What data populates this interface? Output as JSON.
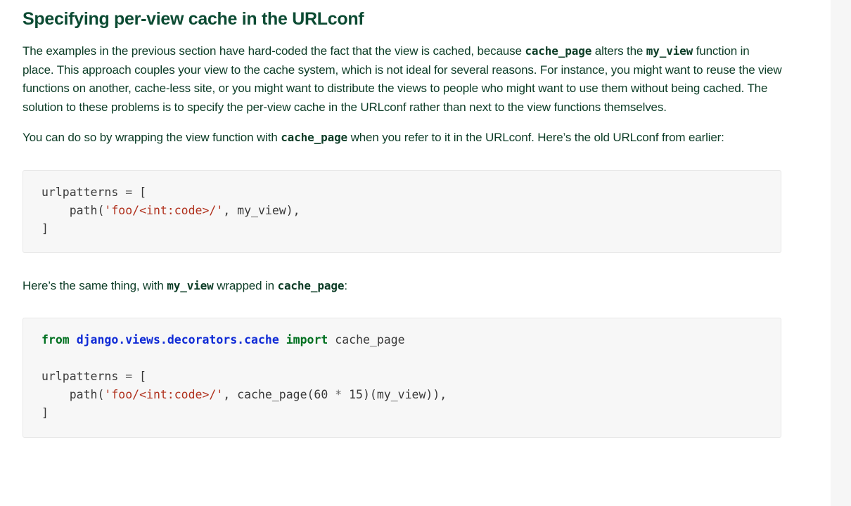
{
  "heading": "Specifying per-view cache in the URLconf",
  "para1": {
    "t1": "The examples in the previous section have hard-coded the fact that the view is cached, because ",
    "c1": "cache_page",
    "t2": " alters the ",
    "c2": "my_view",
    "t3": " function in place. This approach couples your view to the cache system, which is not ideal for several reasons. For instance, you might want to reuse the view functions on another, cache-less site, or you might want to distribute the views to people who might want to use them without being cached. The solution to these problems is to specify the per-view cache in the URLconf rather than next to the view functions themselves."
  },
  "para2": {
    "t1": "You can do so by wrapping the view function with ",
    "c1": "cache_page",
    "t2": " when you refer to it in the URLconf. Here’s the old URLconf from earlier:"
  },
  "code1": {
    "l1_a": "urlpatterns ",
    "l1_op": "=",
    "l1_b": " [",
    "l2_a": "    path(",
    "l2_str": "'foo/<int:code>/'",
    "l2_b": ", my_view),",
    "l3": "]"
  },
  "para3": {
    "t1": "Here’s the same thing, with ",
    "c1": "my_view",
    "t2": " wrapped in ",
    "c2": "cache_page",
    "t3": ":"
  },
  "code2": {
    "l1_from": "from",
    "l1_mod": "django.views.decorators.cache",
    "l1_import": "import",
    "l1_name": " cache_page",
    "l3_a": "urlpatterns ",
    "l3_op": "=",
    "l3_b": " [",
    "l4_a": "    path(",
    "l4_str": "'foo/<int:code>/'",
    "l4_b": ", cache_page(60 ",
    "l4_op": "*",
    "l4_c": " 15)(my_view)),",
    "l5": "]"
  }
}
